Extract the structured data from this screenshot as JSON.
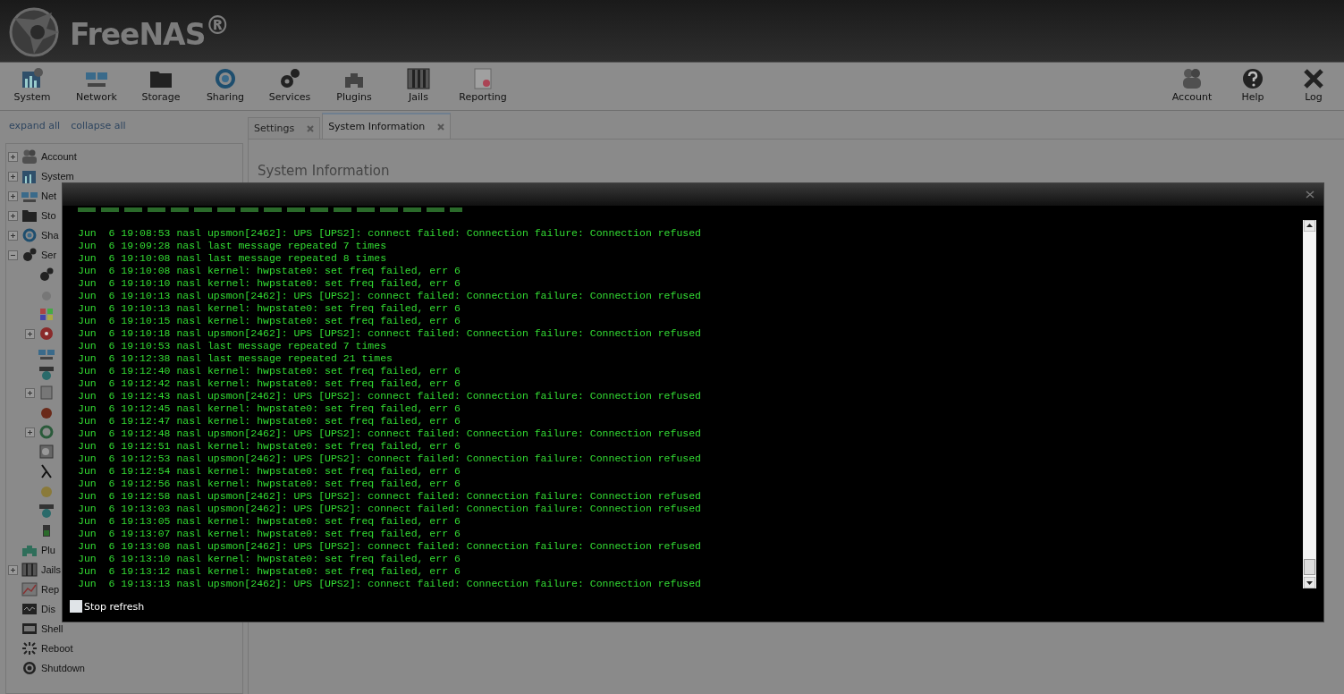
{
  "header": {
    "logo_text": "FreeNAS$^{®}$"
  },
  "toolbar": {
    "left": [
      "System",
      "Network",
      "Storage",
      "Sharing",
      "Services",
      "Plugins",
      "Jails",
      "Reporting"
    ],
    "right": [
      "Account",
      "Help",
      "Log"
    ]
  },
  "tree_links": [
    "expand all",
    "collapse all"
  ],
  "tabs": [
    {
      "label": "Settings",
      "selected": false
    },
    {
      "label": "System Information",
      "selected": true
    }
  ],
  "content": {
    "heading": "System Information"
  },
  "sidebar": {
    "items": [
      {
        "label": "Account",
        "expanded": false
      },
      {
        "label": "System",
        "expanded": false
      },
      {
        "label": "Net",
        "expanded": false
      },
      {
        "label": "Sto",
        "expanded": false
      },
      {
        "label": "Sha",
        "expanded": false
      },
      {
        "label": "Ser",
        "expanded": true,
        "children": [
          {
            "expandable": false
          },
          {
            "expandable": false
          },
          {
            "expandable": false
          },
          {
            "expandable": true,
            "expanded": false
          },
          {
            "expandable": false
          },
          {
            "expandable": false
          },
          {
            "expandable": true,
            "expanded": false
          },
          {
            "expandable": false
          },
          {
            "expandable": true,
            "expanded": false
          },
          {
            "expandable": false
          },
          {
            "expandable": false
          },
          {
            "expandable": false
          },
          {
            "expandable": false
          },
          {
            "expandable": false
          }
        ]
      },
      {
        "label": "Plu"
      },
      {
        "label": "Jails",
        "expanded": false
      },
      {
        "label": "Rep"
      },
      {
        "label": "Dis"
      },
      {
        "label": "Shell"
      },
      {
        "label": "Reboot"
      },
      {
        "label": "Shutdown"
      }
    ]
  },
  "log_dialog": {
    "lines": [
      "Jun  6 19:08:53 nasl upsmon[2462]: UPS [UPS2]: connect failed: Connection failure: Connection refused",
      "Jun  6 19:09:28 nasl last message repeated 7 times",
      "Jun  6 19:10:08 nasl last message repeated 8 times",
      "Jun  6 19:10:08 nasl kernel: hwpstate0: set freq failed, err 6",
      "Jun  6 19:10:10 nasl kernel: hwpstate0: set freq failed, err 6",
      "Jun  6 19:10:13 nasl upsmon[2462]: UPS [UPS2]: connect failed: Connection failure: Connection refused",
      "Jun  6 19:10:13 nasl kernel: hwpstate0: set freq failed, err 6",
      "Jun  6 19:10:15 nasl kernel: hwpstate0: set freq failed, err 6",
      "Jun  6 19:10:18 nasl upsmon[2462]: UPS [UPS2]: connect failed: Connection failure: Connection refused",
      "Jun  6 19:10:53 nasl last message repeated 7 times",
      "Jun  6 19:12:38 nasl last message repeated 21 times",
      "Jun  6 19:12:40 nasl kernel: hwpstate0: set freq failed, err 6",
      "Jun  6 19:12:42 nasl kernel: hwpstate0: set freq failed, err 6",
      "Jun  6 19:12:43 nasl upsmon[2462]: UPS [UPS2]: connect failed: Connection failure: Connection refused",
      "Jun  6 19:12:45 nasl kernel: hwpstate0: set freq failed, err 6",
      "Jun  6 19:12:47 nasl kernel: hwpstate0: set freq failed, err 6",
      "Jun  6 19:12:48 nasl upsmon[2462]: UPS [UPS2]: connect failed: Connection failure: Connection refused",
      "Jun  6 19:12:51 nasl kernel: hwpstate0: set freq failed, err 6",
      "Jun  6 19:12:53 nasl upsmon[2462]: UPS [UPS2]: connect failed: Connection failure: Connection refused",
      "Jun  6 19:12:54 nasl kernel: hwpstate0: set freq failed, err 6",
      "Jun  6 19:12:56 nasl kernel: hwpstate0: set freq failed, err 6",
      "Jun  6 19:12:58 nasl upsmon[2462]: UPS [UPS2]: connect failed: Connection failure: Connection refused",
      "Jun  6 19:13:03 nasl upsmon[2462]: UPS [UPS2]: connect failed: Connection failure: Connection refused",
      "Jun  6 19:13:05 nasl kernel: hwpstate0: set freq failed, err 6",
      "Jun  6 19:13:07 nasl kernel: hwpstate0: set freq failed, err 6",
      "Jun  6 19:13:08 nasl upsmon[2462]: UPS [UPS2]: connect failed: Connection failure: Connection refused",
      "Jun  6 19:13:10 nasl kernel: hwpstate0: set freq failed, err 6",
      "Jun  6 19:13:12 nasl kernel: hwpstate0: set freq failed, err 6",
      "Jun  6 19:13:13 nasl upsmon[2462]: UPS [UPS2]: connect failed: Connection failure: Connection refused"
    ],
    "stop_refresh": {
      "label": "Stop refresh",
      "checked": false
    }
  }
}
